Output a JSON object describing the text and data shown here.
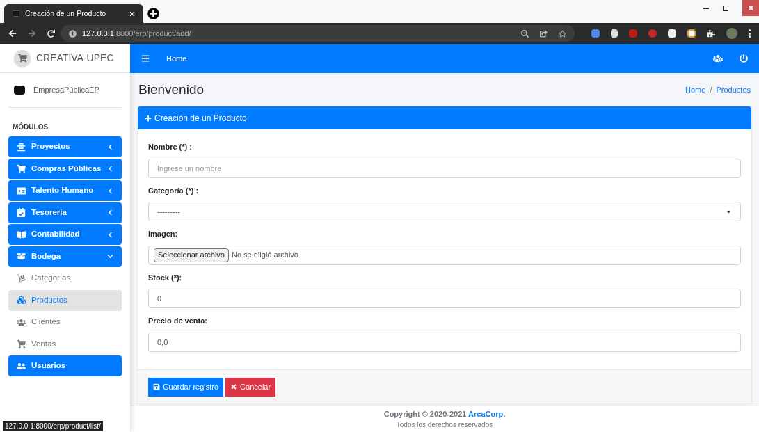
{
  "browser": {
    "tab_title": "Creación de un Producto",
    "tab_close": "×",
    "url_host": "127.0.0.1",
    "url_path": ":8000/erp/product/add/"
  },
  "brand": {
    "name": "CREATIVA-UPEC"
  },
  "user": {
    "name": "EmpresaPúblicaEP"
  },
  "navbar": {
    "link": "Home"
  },
  "sidebar": {
    "header": "MÓDULOS",
    "items": [
      {
        "kind": "module",
        "label": "Proyectos",
        "expanded": false
      },
      {
        "kind": "module",
        "label": "Compras Públicas",
        "expanded": false
      },
      {
        "kind": "module",
        "label": "Talento Humano",
        "expanded": false
      },
      {
        "kind": "module",
        "label": "Tesoreria",
        "expanded": false
      },
      {
        "kind": "module",
        "label": "Contabilidad",
        "expanded": false
      },
      {
        "kind": "module",
        "label": "Bodega",
        "expanded": true
      },
      {
        "kind": "sub",
        "label": "Categorías",
        "selected": false
      },
      {
        "kind": "sub",
        "label": "Productos",
        "selected": true
      },
      {
        "kind": "sub",
        "label": "Clientes",
        "selected": false
      },
      {
        "kind": "sub",
        "label": "Ventas",
        "selected": false
      },
      {
        "kind": "link",
        "label": "Usuarios"
      }
    ]
  },
  "page": {
    "title": "Bienvenido",
    "breadcrumb": [
      "Home",
      "Productos"
    ],
    "breadcrumb_sep": "/"
  },
  "card": {
    "title": "Creación de un Producto",
    "fields": [
      {
        "kind": "text",
        "label": "Nombre (*) :",
        "placeholder": "Ingrese un nombre"
      },
      {
        "kind": "select",
        "label": "Categoría (*) :",
        "value": "---------"
      },
      {
        "kind": "file",
        "label": "Imagen:",
        "button": "Seleccionar archivo",
        "value": "No se eligió archivo"
      },
      {
        "kind": "text",
        "label": "Stock (*):",
        "value": "0"
      },
      {
        "kind": "text",
        "label": "Precio de venta:",
        "value": "0,0"
      }
    ],
    "buttons": [
      {
        "kind": "primary",
        "label": "Guardar registro"
      },
      {
        "kind": "danger",
        "label": "Cancelar"
      }
    ]
  },
  "footer": {
    "copyright": "Copyright © 2020-2021",
    "company": "ArcaCorp",
    "period": ".",
    "rights": "Todos los derechos reservados"
  },
  "status_bar": {
    "url": "127.0.0.1:8000/erp/product/list/"
  }
}
